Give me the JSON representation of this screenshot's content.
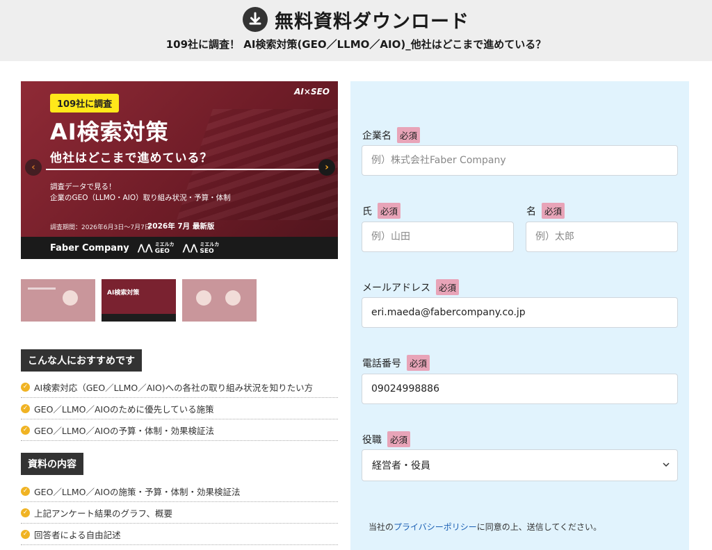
{
  "header": {
    "title": "無料資料ダウンロード",
    "subtitle": "109社に調査！ AI検索対策(GEO／LLMO／AIO)_他社はどこまで進めている？",
    "icon": "download-icon"
  },
  "hero": {
    "badge": "109社に調査",
    "brand": "AI×SEO",
    "title": "AI検索対策",
    "subtitle": "他社はどこまで進めている？",
    "desc_line1": "調査データで見る！",
    "desc_line2": "企業のGEO（LLMO・AIO）取り組み状況・予算・体制",
    "period": "調査期間：2026年6月3日〜7月7日",
    "edition": "2026年 7月 最新版",
    "company": "Faber Company",
    "logo_geo": "GEO",
    "logo_seo": "SEO",
    "logo_prefix": "ミエルカ"
  },
  "thumbnails": {
    "active_text": "AI検索対策"
  },
  "recommend": {
    "heading": "こんな人におすすめです",
    "items": [
      "AI検索対応（GEO／LLMO／AIO)への各社の取り組み状況を知りたい方",
      "GEO／LLMO／AIOのために優先している施策",
      "GEO／LLMO／AIOの予算・体制・効果検証法"
    ]
  },
  "contents": {
    "heading": "資料の内容",
    "items": [
      "GEO／LLMO／AIOの施策・予算・体制・効果検証法",
      "上記アンケート結果のグラフ、概要",
      "回答者による自由記述"
    ]
  },
  "form": {
    "required_label": "必須",
    "company": {
      "label": "企業名",
      "placeholder": "例）株式会社Faber Company",
      "value": ""
    },
    "last_name": {
      "label": "氏",
      "placeholder": "例）山田",
      "value": ""
    },
    "first_name": {
      "label": "名",
      "placeholder": "例）太郎",
      "value": ""
    },
    "email": {
      "label": "メールアドレス",
      "placeholder": "",
      "value": "eri.maeda@fabercompany.co.jp"
    },
    "phone": {
      "label": "電話番号",
      "placeholder": "",
      "value": "09024998886"
    },
    "role": {
      "label": "役職",
      "selected": "経営者・役員"
    },
    "privacy_prefix": "当社の",
    "privacy_link": "プライバシーポリシー",
    "privacy_suffix": "に同意の上、送信してください。"
  },
  "colors": {
    "header_bg": "#eeeeee",
    "form_bg": "#e1f3fd",
    "required_badge": "#e8a4b8",
    "check_icon": "#f0b323",
    "hero_bg": "#7a2230",
    "link": "#1a5fb4"
  }
}
